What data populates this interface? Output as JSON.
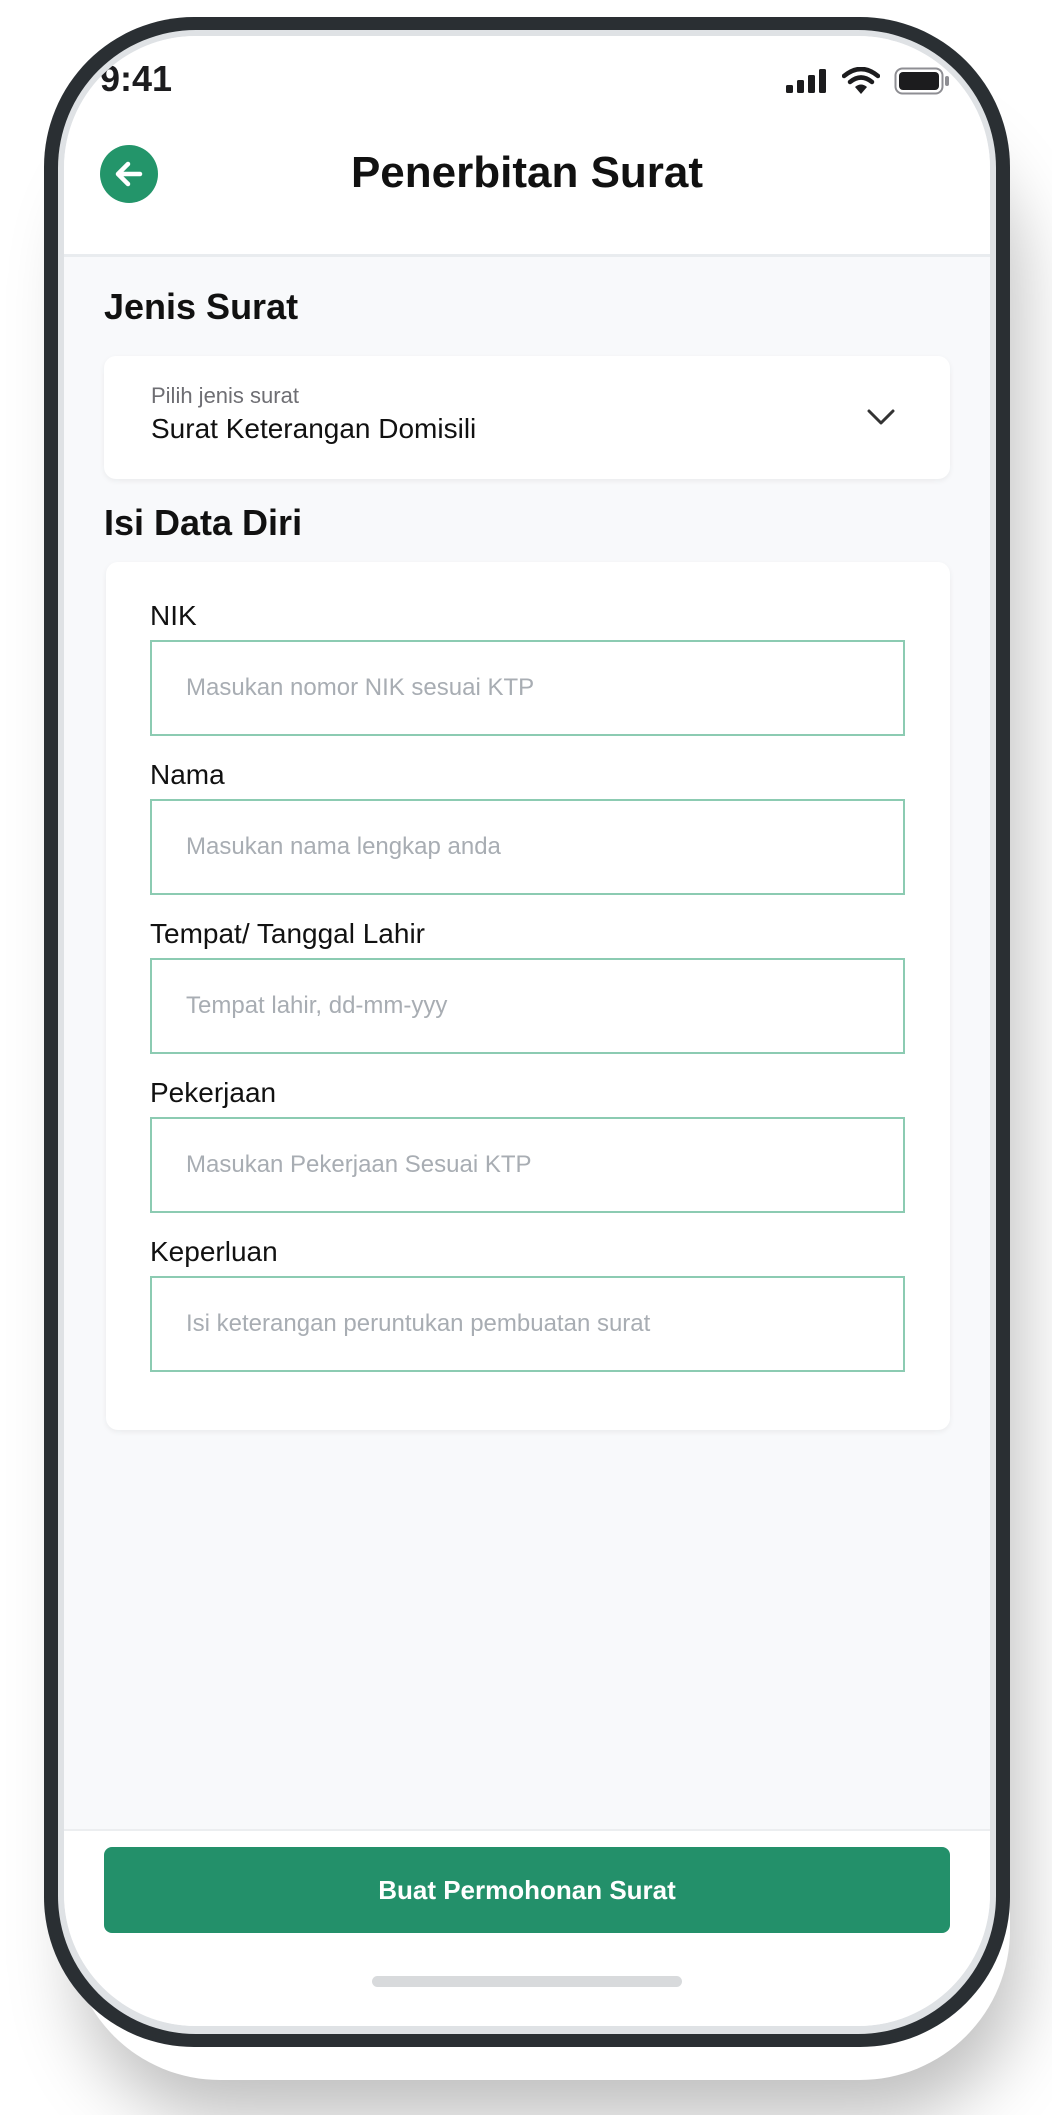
{
  "status_bar": {
    "time": "9:41",
    "icons": [
      "signal-icon",
      "wifi-icon",
      "battery-icon"
    ]
  },
  "header": {
    "back_icon": "arrow-left-icon",
    "title": "Penerbitan Surat"
  },
  "jenis_surat": {
    "title": "Jenis Surat",
    "select_label": "Pilih jenis surat",
    "selected_value": "Surat Keterangan Domisili",
    "dropdown_icon": "chevron-down-icon"
  },
  "data_diri": {
    "title": "Isi Data Diri",
    "fields": [
      {
        "label": "NIK",
        "placeholder": "Masukan nomor NIK sesuai KTP",
        "value": ""
      },
      {
        "label": "Nama",
        "placeholder": "Masukan nama lengkap anda",
        "value": ""
      },
      {
        "label": "Tempat/ Tanggal Lahir",
        "placeholder": "Tempat lahir, dd-mm-yyy",
        "value": ""
      },
      {
        "label": "Pekerjaan",
        "placeholder": "Masukan Pekerjaan Sesuai KTP",
        "value": ""
      },
      {
        "label": "Keperluan",
        "placeholder": "Isi keterangan peruntukan pembuatan surat",
        "value": ""
      }
    ]
  },
  "footer": {
    "submit_label": "Buat Permohonan Surat"
  },
  "colors": {
    "accent": "#23906a",
    "input_border": "#8ccbb2",
    "background": "#f8f9fb"
  }
}
